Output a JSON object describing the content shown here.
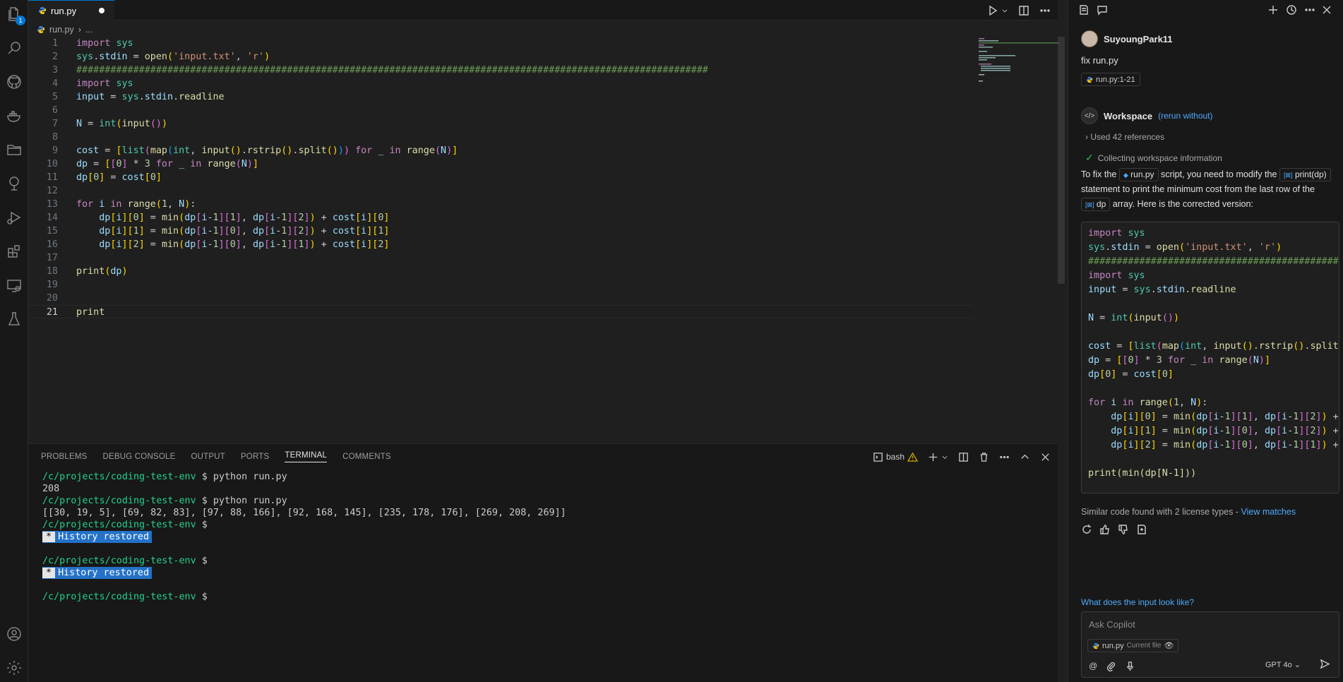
{
  "activity_bar": {
    "explorer_badge": "1",
    "items": [
      "explorer-icon",
      "search-icon",
      "github-icon",
      "docker-icon",
      "folder-icon",
      "source-control-icon",
      "run-debug-icon",
      "extensions-icon",
      "remote-explorer-icon",
      "testing-icon"
    ],
    "bottom": [
      "account-icon",
      "settings-gear-icon"
    ]
  },
  "editor": {
    "tab_label": "run.py",
    "breadcrumb_file": "run.py",
    "breadcrumb_rest": "...",
    "line_numbers": [
      "1",
      "2",
      "3",
      "4",
      "5",
      "6",
      "7",
      "8",
      "9",
      "10",
      "11",
      "12",
      "13",
      "14",
      "15",
      "16",
      "17",
      "18",
      "19",
      "20",
      "21"
    ],
    "comment_line": "###############################################################################################################"
  },
  "panel": {
    "tabs": [
      "PROBLEMS",
      "DEBUG CONSOLE",
      "OUTPUT",
      "PORTS",
      "TERMINAL",
      "COMMENTS"
    ],
    "active_tab": "TERMINAL",
    "shell_label": "bash",
    "terminal": {
      "path": "/c/projects/coding-test-env",
      "prompt": " $ ",
      "cmd": "python run.py",
      "out1": "208",
      "out2": "[[30, 19, 5], [69, 82, 83], [97, 88, 166], [92, 168, 145], [235, 178, 176], [269, 208, 269]]",
      "restored_star": "*",
      "restored_text": "History restored"
    }
  },
  "chat": {
    "user_name": "SuyoungPark11",
    "prompt": "fix run.py",
    "ref_chip": "run.py:1-21",
    "workspace_label": "Workspace",
    "rerun_label": "(rerun without)",
    "used_refs": "Used 42 references",
    "collecting": "Collecting workspace information",
    "answer": {
      "p1": "To fix the",
      "chip1": "run.py",
      "p2": "script, you need to modify the",
      "chip2": "print(dp)",
      "p3": "statement to print the minimum cost from the last row of the",
      "chip3": "dp",
      "p4": "array. Here is the corrected version:"
    },
    "code_last_line": "print(min(dp[N-1]))",
    "similar": "Similar code found with 2 license types - ",
    "view_matches": "View matches",
    "suggestion": "What does the input look like?",
    "ask_placeholder": "Ask Copilot",
    "current_file": "run.py",
    "current_file_sub": "Current file",
    "model": "GPT 4o"
  }
}
